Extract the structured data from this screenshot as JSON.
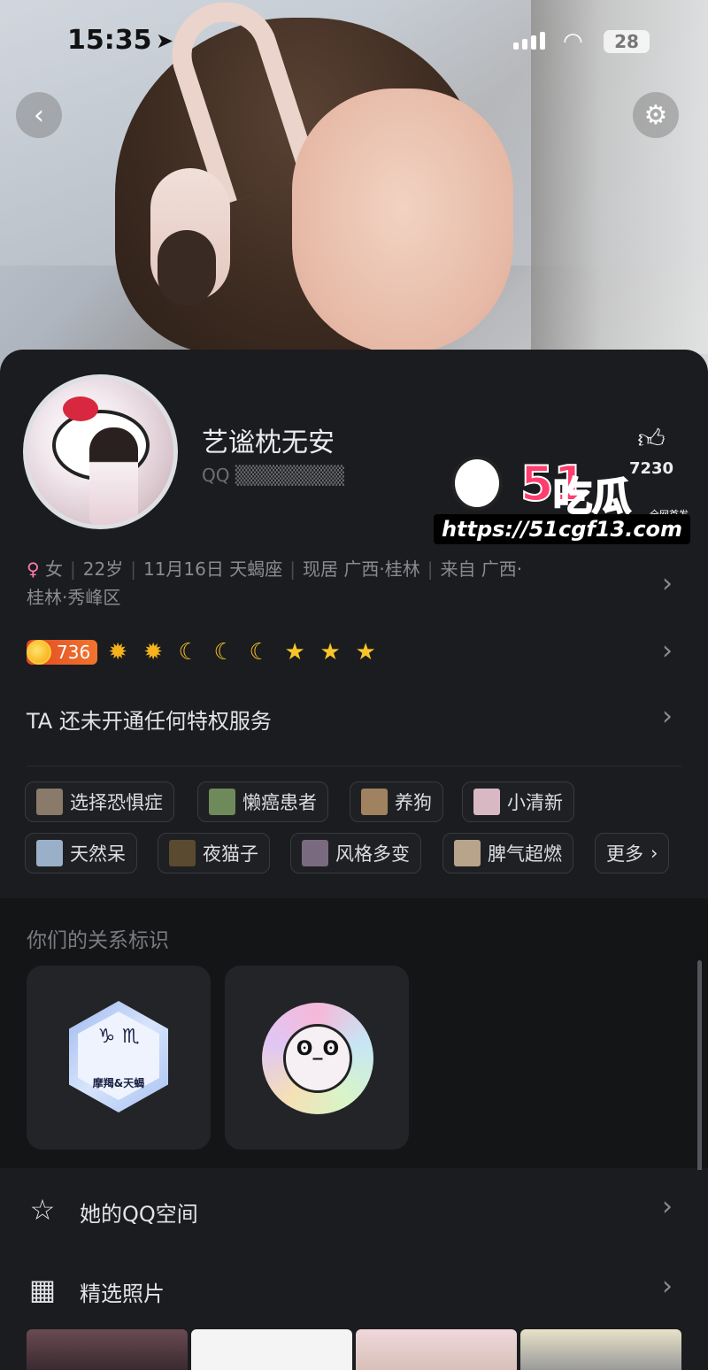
{
  "status_bar": {
    "time": "15:35",
    "battery": "28"
  },
  "profile": {
    "name": "艺谧枕无安",
    "qq_label": "QQ",
    "likes": "7230",
    "info_line1": [
      "女",
      "22岁",
      "11月16日 天蝎座",
      "现居 广西·桂林",
      "来自 广西·"
    ],
    "info_line2": "桂林·秀峰区",
    "level_value": "736",
    "privilege_text": "TA 还未开通任何特权服务"
  },
  "watermark": {
    "logo": "51",
    "brand": "吃瓜",
    "tag": "全网首发",
    "url": "https://51cgf13.com"
  },
  "tags": [
    {
      "label": "选择恐惧症",
      "thumb": "#8a7a6a"
    },
    {
      "label": "懒癌患者",
      "thumb": "#6f8a5a"
    },
    {
      "label": "养狗",
      "thumb": "#a08260"
    },
    {
      "label": "小清新",
      "thumb": "#d8b8c2"
    },
    {
      "label": "天然呆",
      "thumb": "#9ab0c8"
    },
    {
      "label": "夜猫子",
      "thumb": "#5a4a30"
    },
    {
      "label": "风格多变",
      "thumb": "#7a6a80"
    },
    {
      "label": "脾气超燃",
      "thumb": "#b7a48a"
    },
    {
      "label": "更多"
    }
  ],
  "relationship": {
    "title": "你们的关系标识",
    "badge1_symbols": "♑ ♏",
    "badge1_label": "摩羯&天蝎",
    "badge2_face": "ʘ_ʘ"
  },
  "list": {
    "qzone_label": "她的QQ空间",
    "photos_label": "精选照片"
  },
  "colors": {
    "background": "#1b1c1f",
    "accent_pink": "#ff7ba7",
    "level_orange": "#e04a24"
  }
}
